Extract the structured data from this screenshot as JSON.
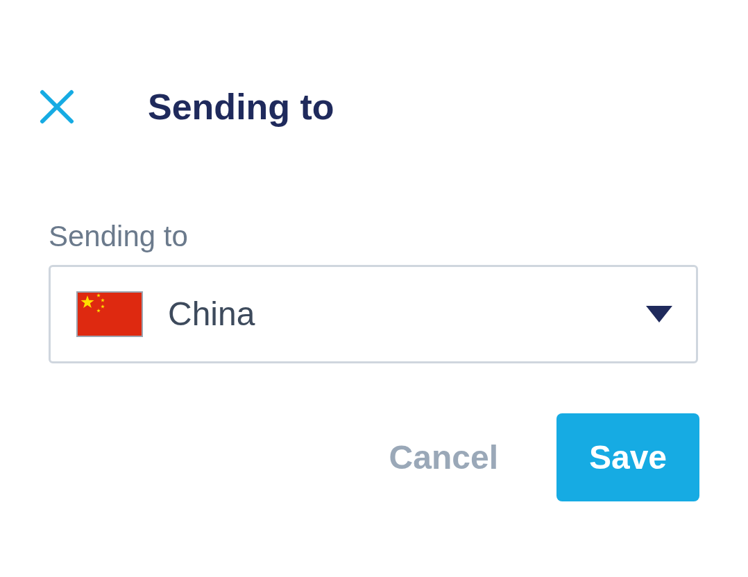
{
  "dialog": {
    "title": "Sending to"
  },
  "field": {
    "label": "Sending to",
    "value": "China"
  },
  "buttons": [
    {
      "label": "Cancel",
      "kind": "text"
    },
    {
      "label": "Save",
      "kind": "primary"
    }
  ]
}
